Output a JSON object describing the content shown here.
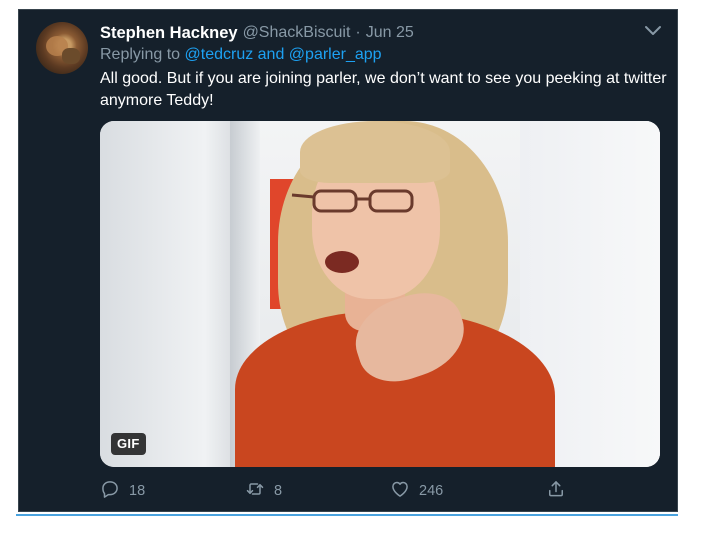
{
  "tweet": {
    "author": {
      "display_name": "Stephen Hackney",
      "handle": "@ShackBiscuit",
      "separator": "·",
      "date": "Jun 25"
    },
    "reply": {
      "prefix": "Replying to ",
      "mentions": "@tedcruz and @parler_app"
    },
    "text": "All good.  But if you are joining parler, we don’t want to see you peeking at twitter anymore Teddy!",
    "media": {
      "badge": "GIF"
    },
    "actions": {
      "replies": "18",
      "retweets": "8",
      "likes": "246"
    }
  },
  "icons": {
    "menu": "chevron-down-icon",
    "reply": "reply-icon",
    "retweet": "retweet-icon",
    "like": "heart-icon",
    "share": "share-icon"
  },
  "colors": {
    "background": "#15202b",
    "link": "#1da1f2",
    "secondary_text": "#8899a6",
    "primary_text": "#ffffff"
  }
}
